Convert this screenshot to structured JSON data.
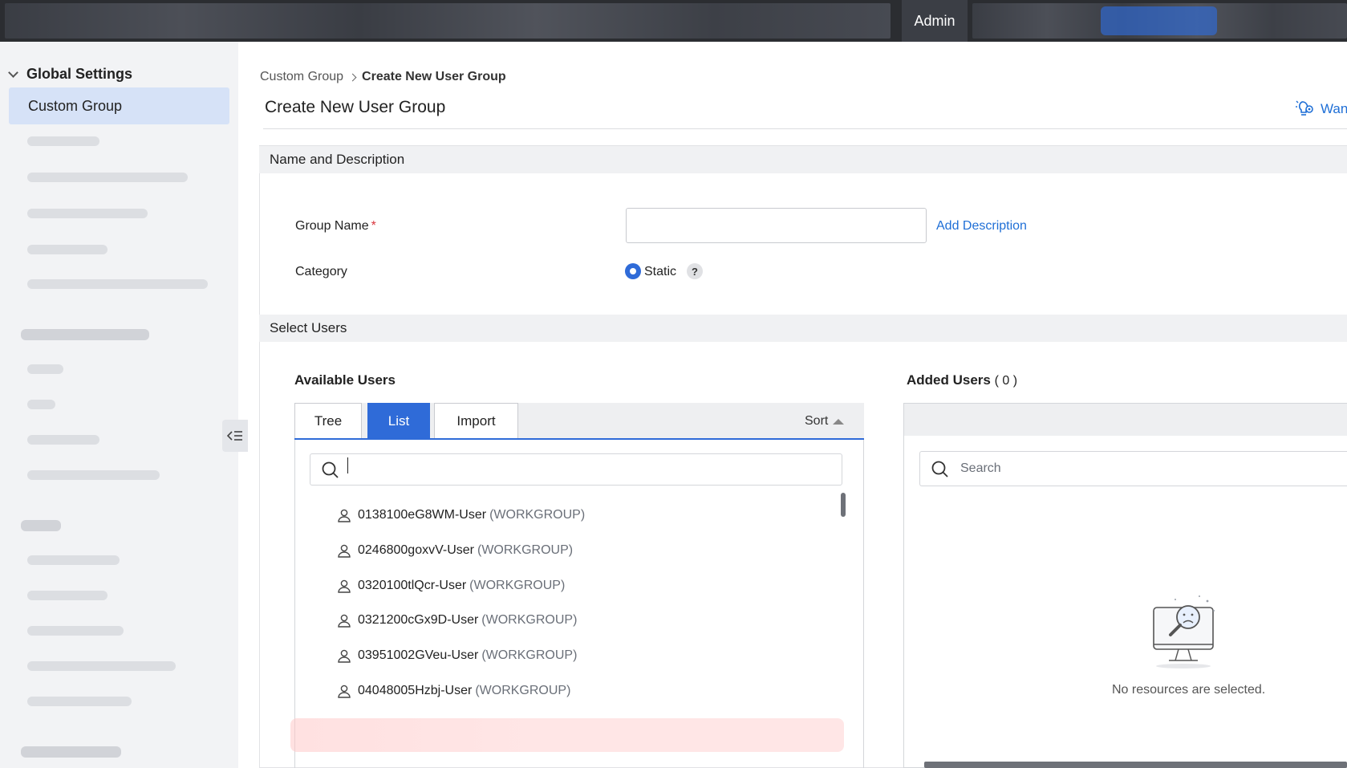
{
  "topbar": {
    "active_tab": "Admin"
  },
  "sidebar": {
    "section_title": "Global Settings",
    "active_item": "Custom Group"
  },
  "breadcrumb": {
    "parent": "Custom Group",
    "current": "Create New User Group"
  },
  "page": {
    "title": "Create New User Group",
    "help_link": "Wan"
  },
  "name_section": {
    "header": "Name and Description",
    "group_name_label": "Group Name",
    "required_mark": "*",
    "group_name_value": "",
    "add_description": "Add Description",
    "category_label": "Category",
    "category_option": "Static",
    "help_glyph": "?"
  },
  "users_section": {
    "header": "Select Users",
    "available_title": "Available Users",
    "added_title": "Added Users",
    "added_count": "( 0 )",
    "tabs": [
      "Tree",
      "List",
      "Import"
    ],
    "active_tab": "List",
    "sort_label": "Sort",
    "added_search_placeholder": "Search",
    "users": [
      {
        "name": "0138100eG8WM-User",
        "domain": "(WORKGROUP)"
      },
      {
        "name": "0246800goxvV-User",
        "domain": "(WORKGROUP)"
      },
      {
        "name": "0320100tlQcr-User",
        "domain": "(WORKGROUP)"
      },
      {
        "name": "0321200cGx9D-User",
        "domain": "(WORKGROUP)"
      },
      {
        "name": "03951002GVeu-User",
        "domain": "(WORKGROUP)"
      },
      {
        "name": "04048005Hzbj-User",
        "domain": "(WORKGROUP)"
      }
    ],
    "empty_message": "No resources are selected."
  },
  "colors": {
    "accent": "#2f6bd8",
    "link": "#1f6fd6",
    "sidebar_active": "#d6e2f7",
    "required": "#d9363e"
  }
}
